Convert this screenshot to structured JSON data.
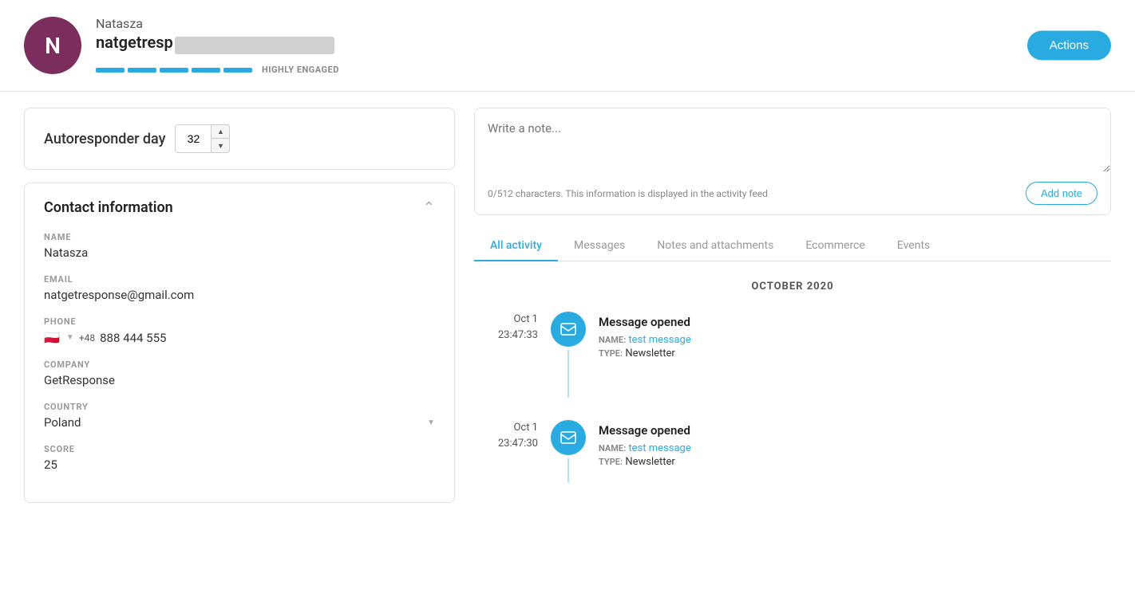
{
  "header": {
    "avatar_letter": "N",
    "avatar_bg": "#7b2d5e",
    "name": "Natasza",
    "email_prefix": "natgetresp",
    "engagement_label": "HIGHLY ENGAGED",
    "engagement_bars": [
      {
        "color": "#29abe2",
        "width": 36
      },
      {
        "color": "#29abe2",
        "width": 36
      },
      {
        "color": "#29abe2",
        "width": 36
      },
      {
        "color": "#29abe2",
        "width": 36
      },
      {
        "color": "#29abe2",
        "width": 36
      }
    ],
    "actions_label": "Actions"
  },
  "autoresponder": {
    "label": "Autoresponder day",
    "day_value": "32"
  },
  "contact": {
    "title": "Contact information",
    "fields": {
      "name_label": "NAME",
      "name_value": "Natasza",
      "email_label": "EMAIL",
      "email_value": "natgetresponse@gmail.com",
      "phone_label": "PHONE",
      "phone_flag": "🇵🇱",
      "phone_code": "+48",
      "phone_number": "888 444 555",
      "company_label": "COMPANY",
      "company_value": "GetResponse",
      "country_label": "COUNTRY",
      "country_value": "Poland",
      "score_label": "SCORE",
      "score_value": "25"
    }
  },
  "note": {
    "placeholder": "Write a note...",
    "char_info": "0/512 characters. This information is displayed in the activity feed",
    "add_label": "Add note"
  },
  "tabs": [
    {
      "label": "All activity",
      "active": true
    },
    {
      "label": "Messages",
      "active": false
    },
    {
      "label": "Notes and attachments",
      "active": false
    },
    {
      "label": "Ecommerce",
      "active": false
    },
    {
      "label": "Events",
      "active": false
    }
  ],
  "activity": {
    "month_label": "OCTOBER 2020",
    "items": [
      {
        "date": "Oct 1",
        "time": "23:47:33",
        "title": "Message opened",
        "name_label": "NAME:",
        "name_value": "test message",
        "type_label": "TYPE:",
        "type_value": "Newsletter"
      },
      {
        "date": "Oct 1",
        "time": "23:47:30",
        "title": "Message opened",
        "name_label": "NAME:",
        "name_value": "test message",
        "type_label": "TYPE:",
        "type_value": "Newsletter"
      }
    ]
  }
}
